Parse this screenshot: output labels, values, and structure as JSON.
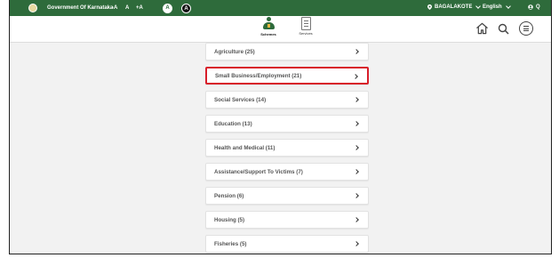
{
  "topbar": {
    "title": "Government Of Karnataka",
    "font_decrease": "-A",
    "font_normal": "A",
    "font_increase": "+A",
    "theme_light": "A",
    "theme_dark": "A",
    "location": "BAGALAKOTE",
    "language": "English",
    "user_initial": "Q"
  },
  "header": {
    "nav": [
      {
        "label": "Schemes",
        "active": true
      },
      {
        "label": "Services",
        "active": false
      }
    ]
  },
  "categories": [
    {
      "label": "Agriculture (25)",
      "highlighted": false
    },
    {
      "label": "Small Business/Employment (21)",
      "highlighted": true
    },
    {
      "label": "Social Services (14)",
      "highlighted": false
    },
    {
      "label": "Education (13)",
      "highlighted": false
    },
    {
      "label": "Health and Medical (11)",
      "highlighted": false
    },
    {
      "label": "Assistance/Support To Victims (7)",
      "highlighted": false
    },
    {
      "label": "Pension (6)",
      "highlighted": false
    },
    {
      "label": "Housing (5)",
      "highlighted": false
    },
    {
      "label": "Fisheries (5)",
      "highlighted": false
    }
  ],
  "colors": {
    "topbar_bg": "#2e6b3b",
    "highlight_border": "#d81e2a",
    "page_bg": "#f2f2f2"
  }
}
